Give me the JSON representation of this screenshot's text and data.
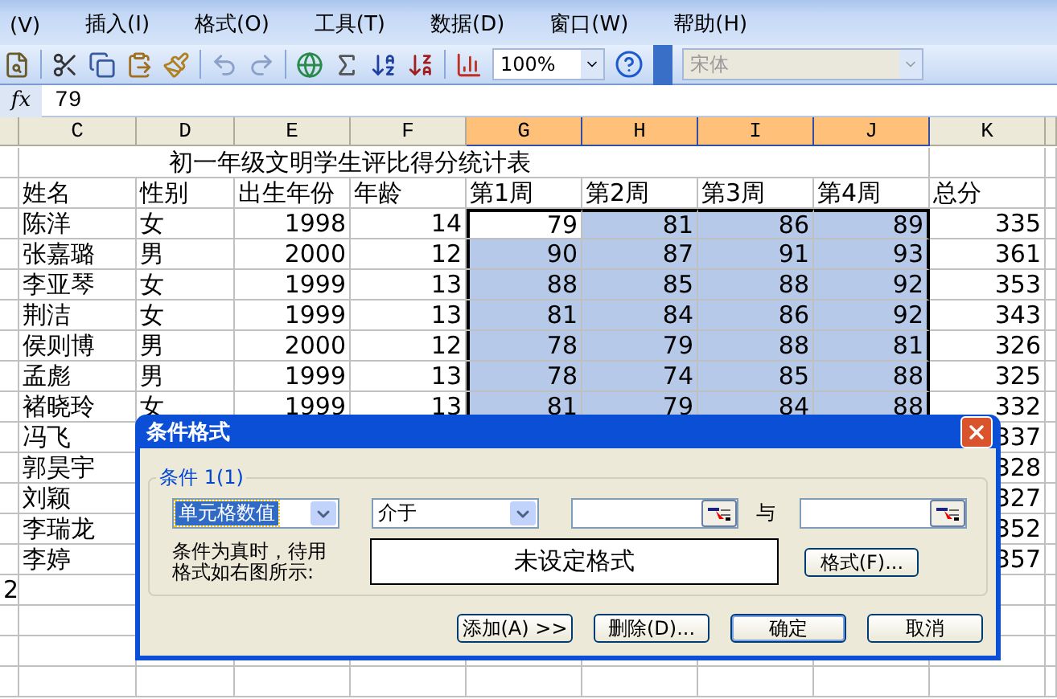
{
  "menu_bar": {
    "items": [
      "(V)",
      "插入(I)",
      "格式(O)",
      "工具(T)",
      "数据(D)",
      "窗口(W)",
      "帮助(H)"
    ]
  },
  "toolbar": {
    "zoom": "100%",
    "font": "宋体"
  },
  "formula_bar": {
    "fx": "fx",
    "value": "79"
  },
  "column_headers": [
    {
      "label": "C",
      "selected": false
    },
    {
      "label": "D",
      "selected": false
    },
    {
      "label": "E",
      "selected": false
    },
    {
      "label": "F",
      "selected": false
    },
    {
      "label": "G",
      "selected": true
    },
    {
      "label": "H",
      "selected": true
    },
    {
      "label": "I",
      "selected": true
    },
    {
      "label": "J",
      "selected": true
    },
    {
      "label": "K",
      "selected": false
    }
  ],
  "sheet": {
    "title": "初一年级文明学生评比得分统计表",
    "headers": [
      "姓名",
      "性别",
      "出生年份",
      "年龄",
      "第1周",
      "第2周",
      "第3周",
      "第4周",
      "总分"
    ],
    "rows": [
      {
        "name": "陈洋",
        "gender": "女",
        "birth_year": "1998",
        "age": "14",
        "weeks": [
          "79",
          "81",
          "86",
          "89"
        ],
        "total": "335",
        "selected": true,
        "active": true
      },
      {
        "name": "张嘉璐",
        "gender": "男",
        "birth_year": "2000",
        "age": "12",
        "weeks": [
          "90",
          "87",
          "91",
          "93"
        ],
        "total": "361",
        "selected": true,
        "active": false
      },
      {
        "name": "李亚琴",
        "gender": "女",
        "birth_year": "1999",
        "age": "13",
        "weeks": [
          "88",
          "85",
          "88",
          "92"
        ],
        "total": "353",
        "selected": true,
        "active": false
      },
      {
        "name": "荆洁",
        "gender": "女",
        "birth_year": "1999",
        "age": "13",
        "weeks": [
          "81",
          "84",
          "86",
          "92"
        ],
        "total": "343",
        "selected": true,
        "active": false
      },
      {
        "name": "侯则博",
        "gender": "男",
        "birth_year": "2000",
        "age": "12",
        "weeks": [
          "78",
          "79",
          "88",
          "81"
        ],
        "total": "326",
        "selected": true,
        "active": false
      },
      {
        "name": "孟彪",
        "gender": "男",
        "birth_year": "1999",
        "age": "13",
        "weeks": [
          "78",
          "74",
          "85",
          "88"
        ],
        "total": "325",
        "selected": true,
        "active": false
      },
      {
        "name": "褚晓玲",
        "gender": "女",
        "birth_year": "1999",
        "age": "13",
        "weeks": [
          "81",
          "79",
          "84",
          "88"
        ],
        "total": "332",
        "selected": true,
        "active": false
      },
      {
        "name": "冯飞",
        "total": "337"
      },
      {
        "name": "郭昊宇",
        "total": "328"
      },
      {
        "name": "刘颖",
        "total": "327"
      },
      {
        "name": "李瑞龙",
        "total": "352"
      },
      {
        "name": "李婷",
        "total": "357"
      },
      {
        "column_b": "2"
      }
    ]
  },
  "dialog": {
    "title": "条件格式",
    "group_label": "条件 1(1)",
    "condition_type": {
      "value": "单元格数值",
      "focused": true
    },
    "operator": {
      "value": "介于"
    },
    "connector": "与",
    "hint": "条件为真时，待用格式如右图所示:",
    "preview": "未设定格式",
    "format_button": "格式(F)...",
    "buttons": [
      {
        "label": "添加(A) >>",
        "default": false
      },
      {
        "label": "删除(D)...",
        "default": false
      },
      {
        "label": "确定",
        "default": true
      },
      {
        "label": "取消",
        "default": false
      }
    ]
  }
}
